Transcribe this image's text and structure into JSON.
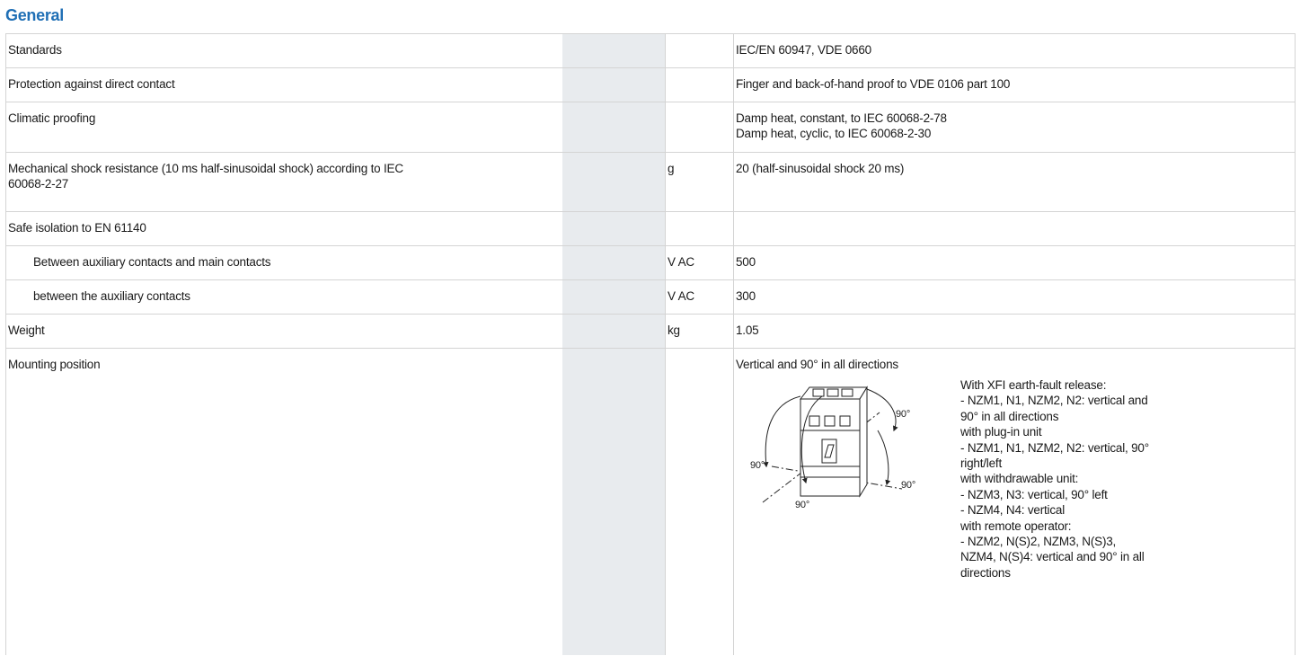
{
  "section": {
    "title": "General"
  },
  "rows": [
    {
      "label": "Standards",
      "unit": "",
      "value": "IEC/EN 60947, VDE 0660"
    },
    {
      "label": "Protection against direct contact",
      "unit": "",
      "value": "Finger and back-of-hand proof to VDE 0106 part 100"
    },
    {
      "label": "Climatic proofing",
      "unit": "",
      "value_lines": [
        "Damp heat, constant, to IEC 60068-2-78",
        "Damp heat, cyclic, to IEC 60068-2-30"
      ]
    },
    {
      "label_lines": [
        "Mechanical shock resistance (10 ms half-sinusoidal shock) according to IEC",
        "60068-2-27"
      ],
      "unit": "g",
      "value": "20 (half-sinusoidal shock 20 ms)"
    },
    {
      "label": "Safe isolation to EN 61140",
      "unit": "",
      "value": ""
    },
    {
      "label": "Between auxiliary contacts and main contacts",
      "unit": "V AC",
      "value": "500"
    },
    {
      "label": "between the auxiliary contacts",
      "unit": "V AC",
      "value": "300"
    },
    {
      "label": "Weight",
      "unit": "kg",
      "value": "1.05"
    },
    {
      "label": "Mounting position",
      "unit": "",
      "value": "Vertical and 90° in all directions"
    }
  ],
  "mounting": {
    "figure_angle_labels": [
      "90°",
      "90°",
      "90°",
      "90°"
    ],
    "note_lines": [
      "With XFI earth-fault release:",
      "- NZM1, N1, NZM2, N2: vertical and",
      "90° in all directions",
      "with plug-in unit",
      "- NZM1, N1, NZM2, N2: vertical, 90°",
      "right/left",
      "with withdrawable unit:",
      "- NZM3, N3: vertical, 90° left",
      "- NZM4, N4: vertical",
      "with remote operator:",
      "- NZM2, N(S)2, NZM3, N(S)3,",
      "NZM4, N(S)4: vertical and 90° in all",
      "directions"
    ]
  },
  "colors": {
    "title": "#1f6fb5",
    "unit_column_shade": "#e8ebee",
    "grid": "#d4d4d4"
  }
}
